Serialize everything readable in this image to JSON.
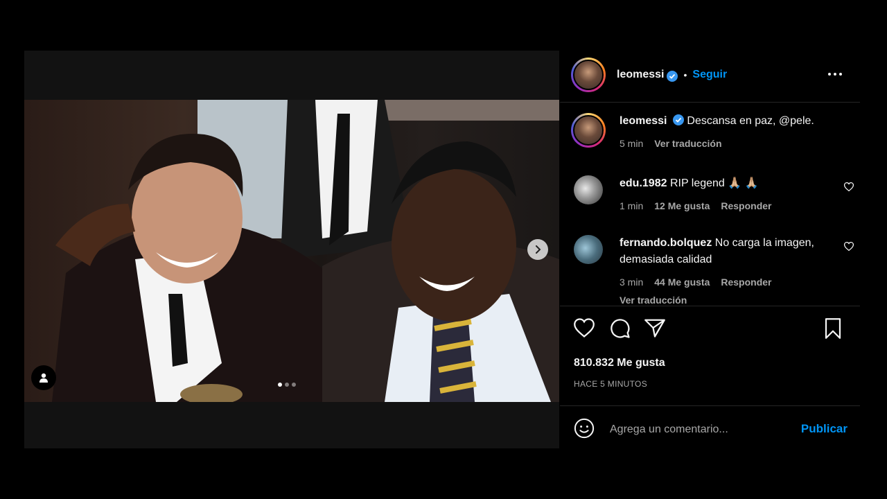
{
  "post": {
    "username": "leomessi",
    "follow_label": "Seguir",
    "separator": "•",
    "caption_text": "Descansa en paz, @pele.",
    "caption_time": "5 min",
    "caption_translate": "Ver traducción"
  },
  "comments": [
    {
      "username": "edu.1982",
      "text": "RIP legend 🙏🏼 🙏🏼",
      "time": "1 min",
      "likes": "12 Me gusta",
      "reply": "Responder"
    },
    {
      "username": "fernando.bolquez",
      "text": "No carga la imagen, demasiada calidad",
      "time": "3 min",
      "likes": "44 Me gusta",
      "reply": "Responder",
      "translate": "Ver traducción"
    }
  ],
  "stats": {
    "likes": "810.832 Me gusta",
    "time": "HACE 5 MINUTOS"
  },
  "composer": {
    "placeholder": "Agrega un comentario...",
    "publish_label": "Publicar"
  },
  "carousel": {
    "total": 3,
    "active": 1
  },
  "colors": {
    "accent": "#0095f6",
    "verified": "#3897f0",
    "muted": "#a8a8a8",
    "divider": "#262626"
  }
}
